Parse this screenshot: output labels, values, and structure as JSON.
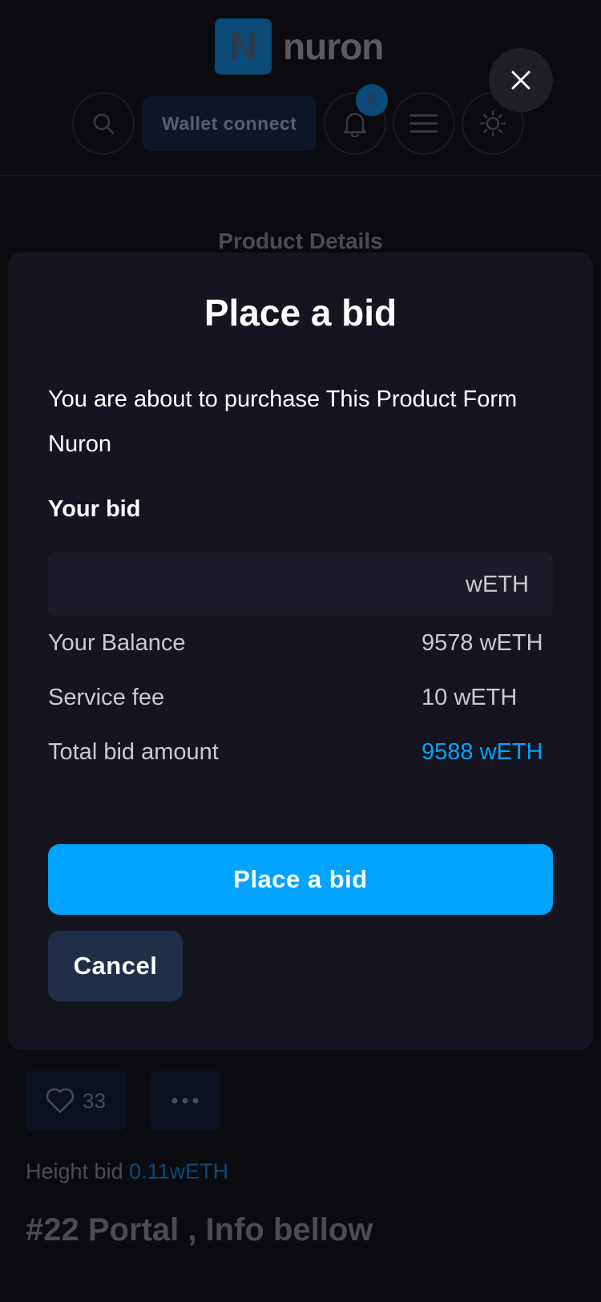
{
  "brand": {
    "mark": "N",
    "name": "nuron"
  },
  "header": {
    "wallet_label": "Wallet connect",
    "notification_count": "6"
  },
  "background": {
    "section_title": "Product Details",
    "likes": "33",
    "highest_bid_label": "Height bid",
    "highest_bid_value": "0.11wETH",
    "product_title": "#22 Portal , Info bellow"
  },
  "modal": {
    "title": "Place a bid",
    "description": "You are about to purchase This Product Form Nuron",
    "bid_label": "Your bid",
    "bid_input": {
      "value": "",
      "placeholder": "",
      "unit": "wETH"
    },
    "rows": [
      {
        "label": "Your Balance",
        "value": "9578 wETH"
      },
      {
        "label": "Service fee",
        "value": "10 wETH"
      },
      {
        "label": "Total bid amount",
        "value": "9588 wETH"
      }
    ],
    "place_bid_label": "Place a bid",
    "cancel_label": "Cancel"
  },
  "colors": {
    "accent": "#00a3ff",
    "modal_bg": "#15151f",
    "cancel_bg": "#212e4a"
  }
}
